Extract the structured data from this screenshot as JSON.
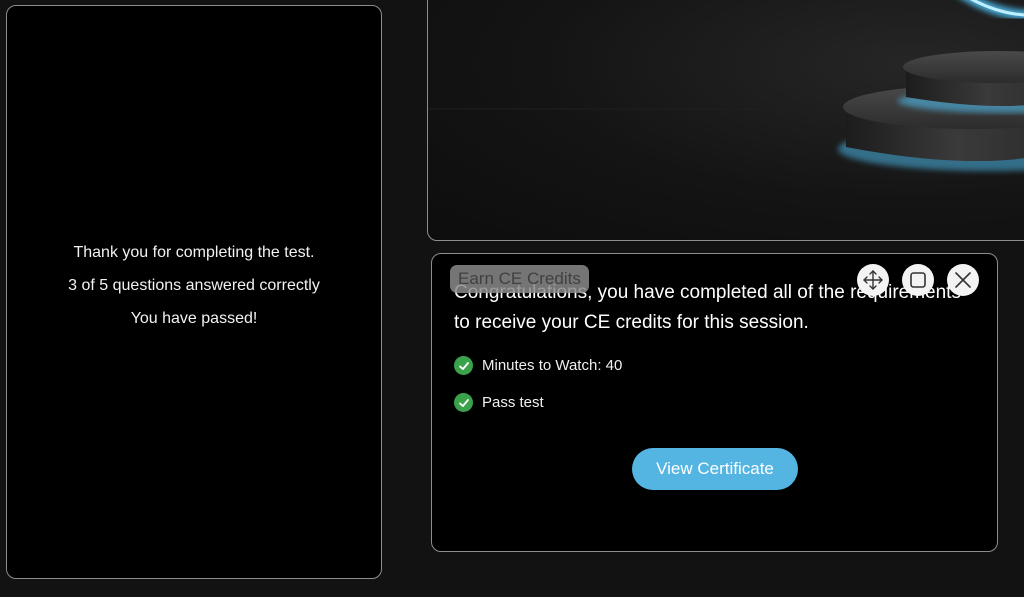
{
  "test_result": {
    "thank_you": "Thank you for completing the test.",
    "score": "3 of 5 questions answered correctly",
    "status": "You have passed!"
  },
  "ce_panel": {
    "tab_label": "Earn CE Credits",
    "message": "Congratulations, you have completed all of the requirements to receive your CE credits for this session.",
    "requirements": [
      {
        "label": "Minutes to Watch: 40",
        "icon": "check-circle-icon"
      },
      {
        "label": "Pass test",
        "icon": "check-circle-icon"
      }
    ],
    "button_label": "View Certificate"
  },
  "controls": {
    "move_icon": "move-icon",
    "maximize_icon": "maximize-icon",
    "close_icon": "close-icon"
  },
  "colors": {
    "accent_button": "#54b4e2",
    "check_green": "#3aa24a",
    "glow_blue": "#4fc3f7"
  }
}
